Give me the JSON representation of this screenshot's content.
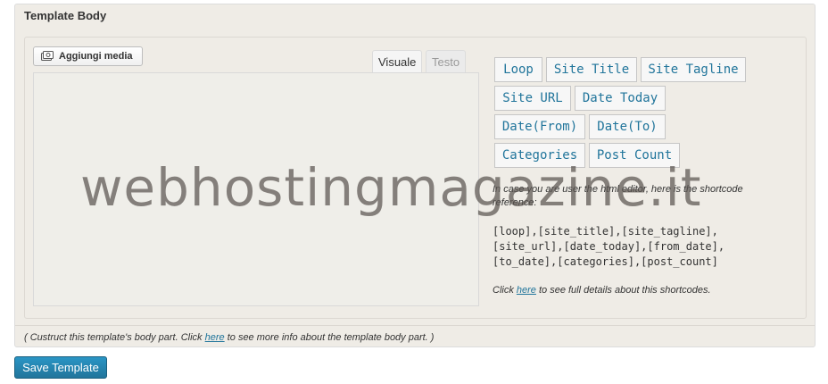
{
  "postbox": {
    "title": "Template Body"
  },
  "editor": {
    "add_media_label": "Aggiungi media",
    "tabs": [
      {
        "label": "Visuale",
        "active": true
      },
      {
        "label": "Testo",
        "active": false
      }
    ]
  },
  "shortcodes": {
    "buttons": [
      "Loop",
      "Site Title",
      "Site Tagline",
      "Site URL",
      "Date Today",
      "Date(From)",
      "Date(To)",
      "Categories",
      "Post Count"
    ],
    "reference_note": "In case you are user the html editor, here is the shortcode reference:",
    "reference_codes": [
      "[loop],[site_title],[site_tagline],",
      "[site_url],[date_today],[from_date],",
      "[to_date],[categories],[post_count]"
    ],
    "details_prefix": "Click ",
    "details_link": "here",
    "details_suffix": " to see full details about this shortcodes."
  },
  "footer": {
    "note_prefix": "( Custruct this template's body part. Click ",
    "note_link": "here",
    "note_suffix": " to see more info about the template body part. )"
  },
  "save_button_label": "Save Template",
  "watermark_text": "webhostingmagazine.it",
  "colors": {
    "link": "#21759b",
    "primary_button": "#21759b",
    "panel_bg": "#efece6"
  }
}
